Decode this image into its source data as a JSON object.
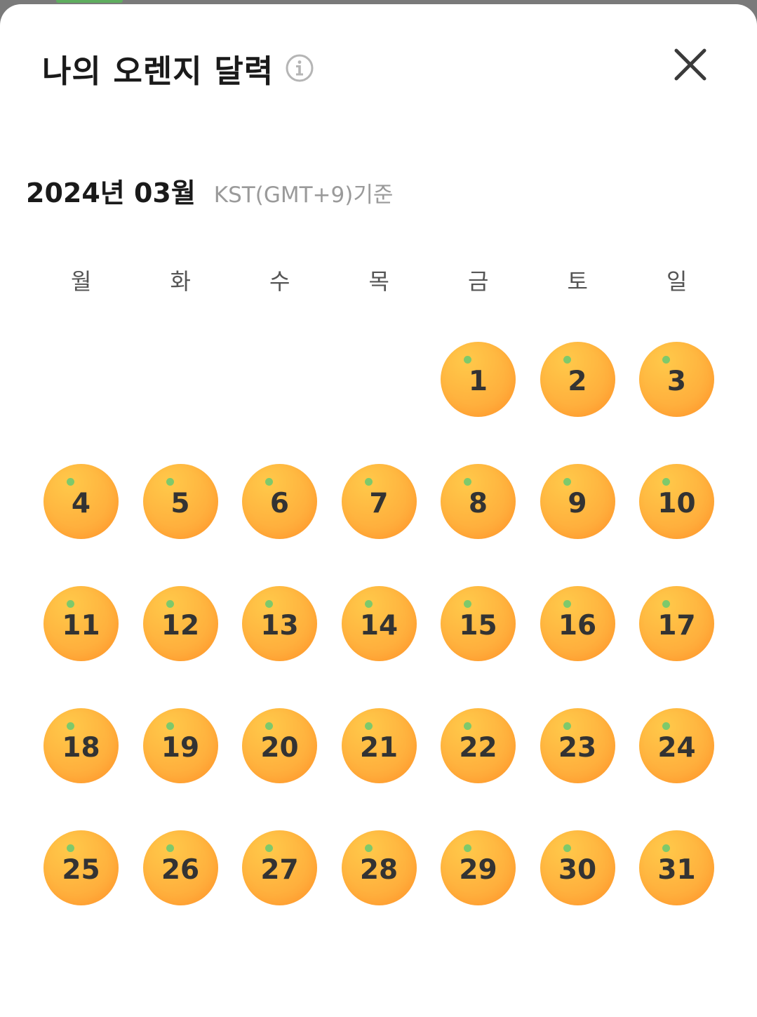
{
  "header": {
    "title": "나의 오렌지 달력",
    "info_icon": "info-circle-icon",
    "close_icon": "close-x-icon"
  },
  "month": {
    "label": "2024년 03월",
    "timezone_note": "KST(GMT+9)기준"
  },
  "weekdays": [
    "월",
    "화",
    "수",
    "목",
    "금",
    "토",
    "일"
  ],
  "calendar": {
    "first_weekday_index": 4,
    "days": [
      "1",
      "2",
      "3",
      "4",
      "5",
      "6",
      "7",
      "8",
      "9",
      "10",
      "11",
      "12",
      "13",
      "14",
      "15",
      "16",
      "17",
      "18",
      "19",
      "20",
      "21",
      "22",
      "23",
      "24",
      "25",
      "26",
      "27",
      "28",
      "29",
      "30",
      "31"
    ],
    "day_icon": "orange-icon"
  },
  "colors": {
    "orange": "#ffb640",
    "leaf": "#7ec96b",
    "title_text": "#1a1a1a",
    "muted_text": "#9a9a9a"
  }
}
